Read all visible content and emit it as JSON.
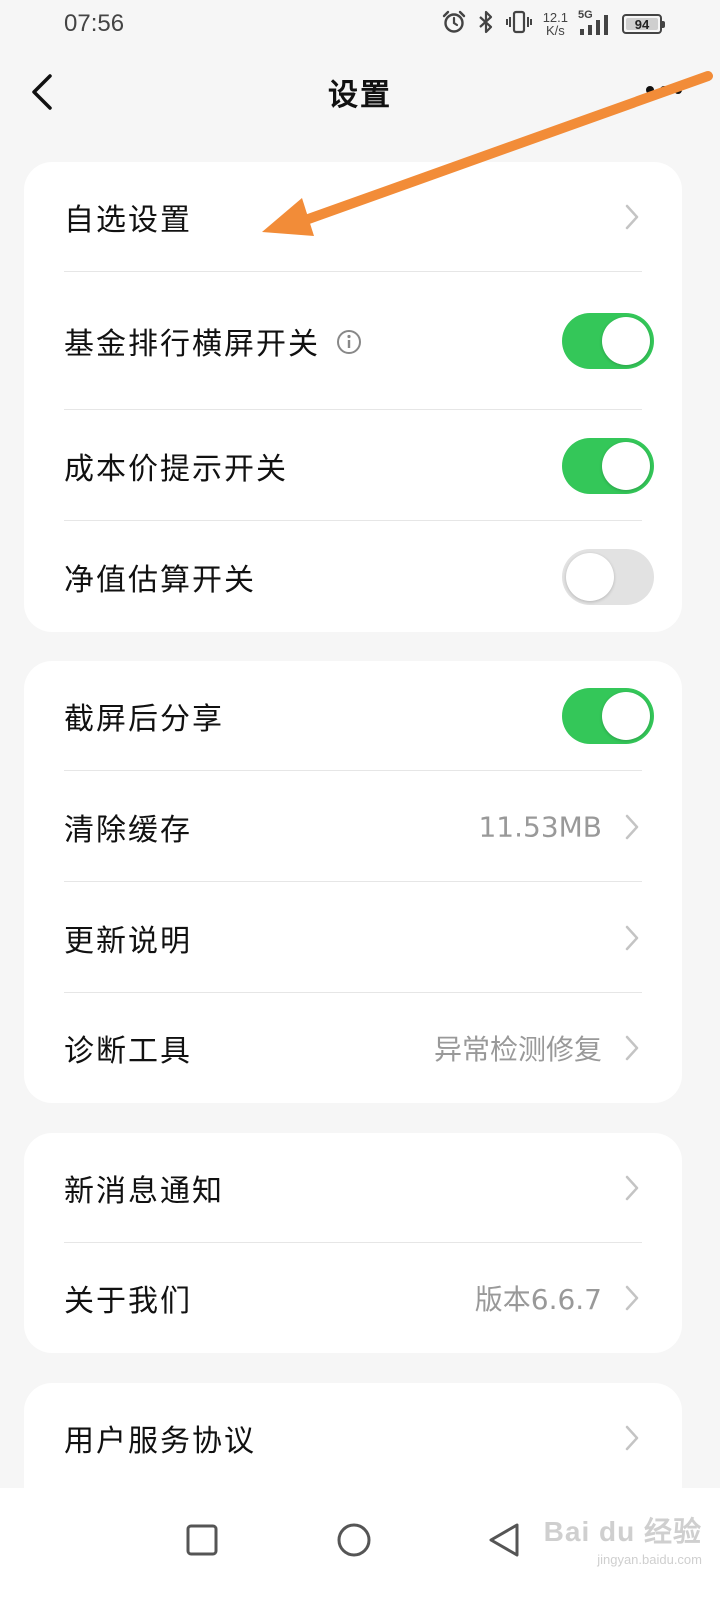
{
  "status_bar": {
    "time": "07:56",
    "net_speed_value": "12.1",
    "net_speed_unit": "K/s",
    "network_type": "5G",
    "battery_level": "94",
    "icons": [
      "alarm-icon",
      "bluetooth-icon",
      "vibrate-icon",
      "signal-icon",
      "battery-icon"
    ]
  },
  "nav": {
    "title": "设置",
    "back_icon": "chevron-left-icon",
    "more_icon": "more-dots-icon"
  },
  "sections": [
    {
      "rows": [
        {
          "label": "自选设置",
          "type": "link"
        },
        {
          "label": "基金排行横屏开关",
          "type": "toggle",
          "on": true,
          "has_info": true
        },
        {
          "label": "成本价提示开关",
          "type": "toggle",
          "on": true
        },
        {
          "label": "净值估算开关",
          "type": "toggle",
          "on": false
        }
      ]
    },
    {
      "rows": [
        {
          "label": "截屏后分享",
          "type": "toggle",
          "on": true
        },
        {
          "label": "清除缓存",
          "type": "link",
          "value": "11.53MB"
        },
        {
          "label": "更新说明",
          "type": "link"
        },
        {
          "label": "诊断工具",
          "type": "link",
          "value": "异常检测修复"
        }
      ]
    },
    {
      "rows": [
        {
          "label": "新消息通知",
          "type": "link"
        },
        {
          "label": "关于我们",
          "type": "link",
          "value": "版本6.6.7"
        }
      ]
    },
    {
      "rows": [
        {
          "label": "用户服务协议",
          "type": "link"
        }
      ]
    }
  ],
  "colors": {
    "toggle_on": "#34c759",
    "toggle_off": "#e2e2e2",
    "annotation_arrow": "#f28c38",
    "background": "#f6f6f6"
  },
  "system_nav": {
    "keys": [
      "recent-apps-square-icon",
      "home-circle-icon",
      "back-triangle-icon"
    ]
  },
  "watermark": {
    "main": "Bai du 经验",
    "sub": "jingyan.baidu.com"
  }
}
